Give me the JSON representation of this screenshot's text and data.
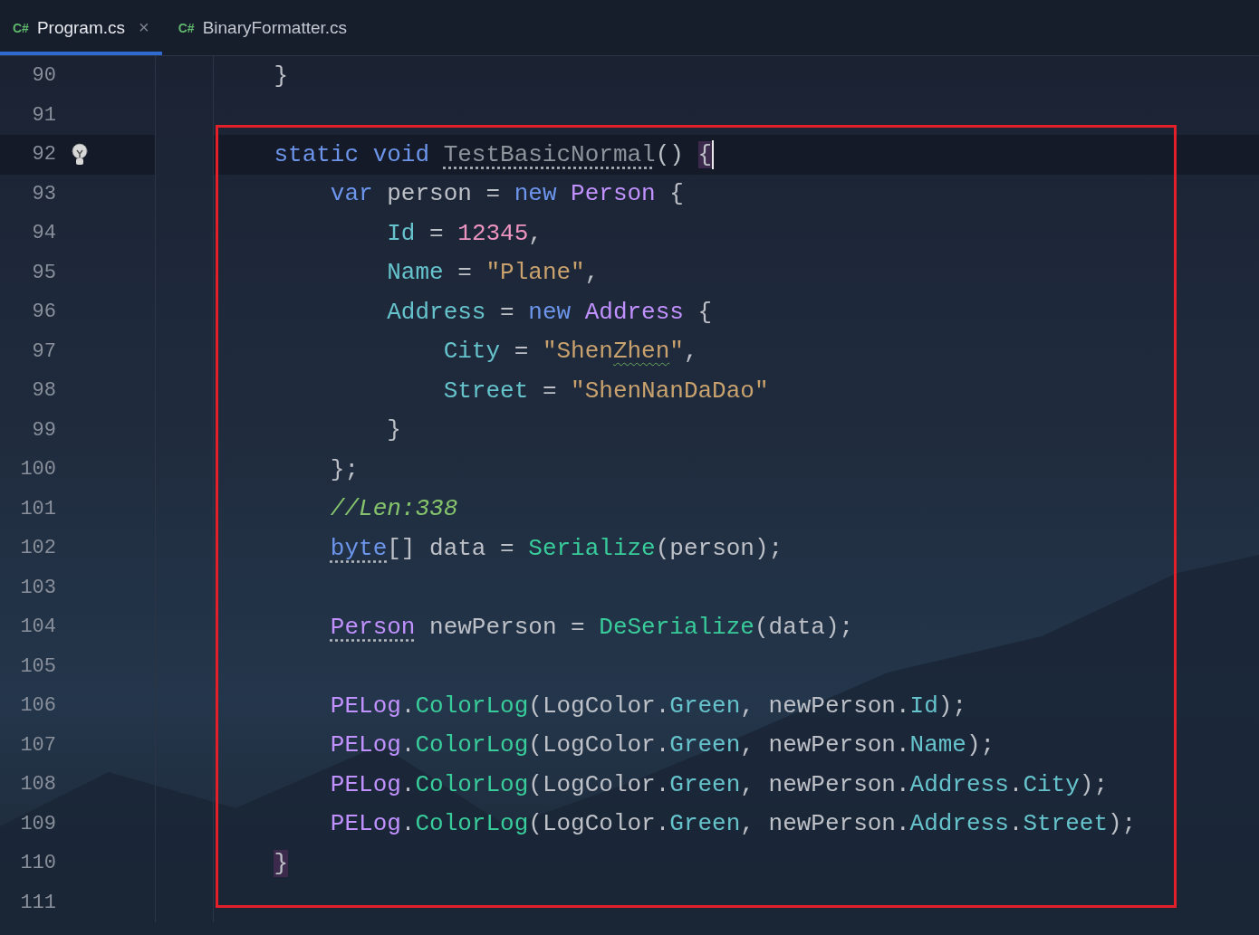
{
  "tabs": [
    {
      "lang": "C#",
      "label": "Program.cs",
      "selected": true,
      "close_glyph": "×"
    },
    {
      "lang": "C#",
      "label": "BinaryFormatter.cs",
      "selected": false
    }
  ],
  "lines": [
    {
      "number": "90",
      "tokens": [
        {
          "text": "    }",
          "kind": "plain"
        }
      ]
    },
    {
      "number": "91"
    },
    {
      "number": "92",
      "current": true,
      "bulb": true,
      "caret": true,
      "framed": true,
      "tokens": [
        {
          "text": "    static void ",
          "kind": "keyword"
        },
        {
          "text": "TestBasicNormal",
          "kind": "unused",
          "dotted_underline": true
        },
        {
          "text": "() ",
          "kind": "plain"
        },
        {
          "text": "{",
          "kind": "plain",
          "matched": true
        }
      ]
    },
    {
      "number": "93",
      "framed": true,
      "tokens": [
        {
          "text": "        var ",
          "kind": "keyword"
        },
        {
          "text": "person = ",
          "kind": "plain"
        },
        {
          "text": "new ",
          "kind": "keyword"
        },
        {
          "text": "Person",
          "kind": "type"
        },
        {
          "text": " {",
          "kind": "plain"
        }
      ]
    },
    {
      "number": "94",
      "framed": true,
      "tokens": [
        {
          "text": "            Id",
          "kind": "field"
        },
        {
          "text": " = ",
          "kind": "plain"
        },
        {
          "text": "12345",
          "kind": "number"
        },
        {
          "text": ",",
          "kind": "plain"
        }
      ]
    },
    {
      "number": "95",
      "framed": true,
      "tokens": [
        {
          "text": "            Name",
          "kind": "field"
        },
        {
          "text": " = ",
          "kind": "plain"
        },
        {
          "text": "\"Plane\"",
          "kind": "string"
        },
        {
          "text": ",",
          "kind": "plain"
        }
      ]
    },
    {
      "number": "96",
      "framed": true,
      "tokens": [
        {
          "text": "            Address",
          "kind": "field"
        },
        {
          "text": " = ",
          "kind": "plain"
        },
        {
          "text": "new ",
          "kind": "keyword"
        },
        {
          "text": "Address",
          "kind": "type"
        },
        {
          "text": " {",
          "kind": "plain"
        }
      ]
    },
    {
      "number": "97",
      "framed": true,
      "tokens": [
        {
          "text": "                City",
          "kind": "field"
        },
        {
          "text": " = ",
          "kind": "plain"
        },
        {
          "text": "\"Shen",
          "kind": "string"
        },
        {
          "text": "Zhen",
          "kind": "string",
          "wavy_underline": true
        },
        {
          "text": "\"",
          "kind": "string"
        },
        {
          "text": ",",
          "kind": "plain"
        }
      ]
    },
    {
      "number": "98",
      "framed": true,
      "tokens": [
        {
          "text": "                Street",
          "kind": "field"
        },
        {
          "text": " = ",
          "kind": "plain"
        },
        {
          "text": "\"ShenNanDaDao\"",
          "kind": "string"
        }
      ]
    },
    {
      "number": "99",
      "framed": true,
      "tokens": [
        {
          "text": "            }",
          "kind": "plain"
        }
      ]
    },
    {
      "number": "100",
      "framed": true,
      "tokens": [
        {
          "text": "        };",
          "kind": "plain"
        }
      ]
    },
    {
      "number": "101",
      "framed": true,
      "tokens": [
        {
          "text": "        //Len:338",
          "kind": "comment"
        }
      ]
    },
    {
      "number": "102",
      "framed": true,
      "tokens": [
        {
          "text": "        byte",
          "kind": "keyword",
          "dotted_underline": true
        },
        {
          "text": "[] data = ",
          "kind": "plain"
        },
        {
          "text": "Serialize",
          "kind": "method"
        },
        {
          "text": "(person);",
          "kind": "plain"
        }
      ]
    },
    {
      "number": "103",
      "framed": true
    },
    {
      "number": "104",
      "framed": true,
      "tokens": [
        {
          "text": "        Person",
          "kind": "type",
          "dotted_underline": true
        },
        {
          "text": " newPerson = ",
          "kind": "plain"
        },
        {
          "text": "DeSerialize",
          "kind": "method"
        },
        {
          "text": "(data);",
          "kind": "plain"
        }
      ]
    },
    {
      "number": "105",
      "framed": true
    },
    {
      "number": "106",
      "framed": true,
      "tokens": [
        {
          "text": "        PELog",
          "kind": "type"
        },
        {
          "text": ".",
          "kind": "plain"
        },
        {
          "text": "ColorLog",
          "kind": "method"
        },
        {
          "text": "(LogColor.",
          "kind": "plain"
        },
        {
          "text": "Green",
          "kind": "field"
        },
        {
          "text": ", newPerson.",
          "kind": "plain"
        },
        {
          "text": "Id",
          "kind": "field"
        },
        {
          "text": ");",
          "kind": "plain"
        }
      ]
    },
    {
      "number": "107",
      "framed": true,
      "tokens": [
        {
          "text": "        PELog",
          "kind": "type"
        },
        {
          "text": ".",
          "kind": "plain"
        },
        {
          "text": "ColorLog",
          "kind": "method"
        },
        {
          "text": "(LogColor.",
          "kind": "plain"
        },
        {
          "text": "Green",
          "kind": "field"
        },
        {
          "text": ", newPerson.",
          "kind": "plain"
        },
        {
          "text": "Name",
          "kind": "field"
        },
        {
          "text": ");",
          "kind": "plain"
        }
      ]
    },
    {
      "number": "108",
      "framed": true,
      "tokens": [
        {
          "text": "        PELog",
          "kind": "type"
        },
        {
          "text": ".",
          "kind": "plain"
        },
        {
          "text": "ColorLog",
          "kind": "method"
        },
        {
          "text": "(LogColor.",
          "kind": "plain"
        },
        {
          "text": "Green",
          "kind": "field"
        },
        {
          "text": ", newPerson.",
          "kind": "plain"
        },
        {
          "text": "Address",
          "kind": "field"
        },
        {
          "text": ".",
          "kind": "plain"
        },
        {
          "text": "City",
          "kind": "field"
        },
        {
          "text": ");",
          "kind": "plain"
        }
      ]
    },
    {
      "number": "109",
      "framed": true,
      "tokens": [
        {
          "text": "        PELog",
          "kind": "type"
        },
        {
          "text": ".",
          "kind": "plain"
        },
        {
          "text": "ColorLog",
          "kind": "method"
        },
        {
          "text": "(LogColor.",
          "kind": "plain"
        },
        {
          "text": "Green",
          "kind": "field"
        },
        {
          "text": ", newPerson.",
          "kind": "plain"
        },
        {
          "text": "Address",
          "kind": "field"
        },
        {
          "text": ".",
          "kind": "plain"
        },
        {
          "text": "Street",
          "kind": "field"
        },
        {
          "text": ");",
          "kind": "plain"
        }
      ]
    },
    {
      "number": "110",
      "framed": true,
      "tokens": [
        {
          "text": "    }",
          "kind": "plain",
          "matched": true
        }
      ]
    },
    {
      "number": "111",
      "framed": true
    }
  ]
}
